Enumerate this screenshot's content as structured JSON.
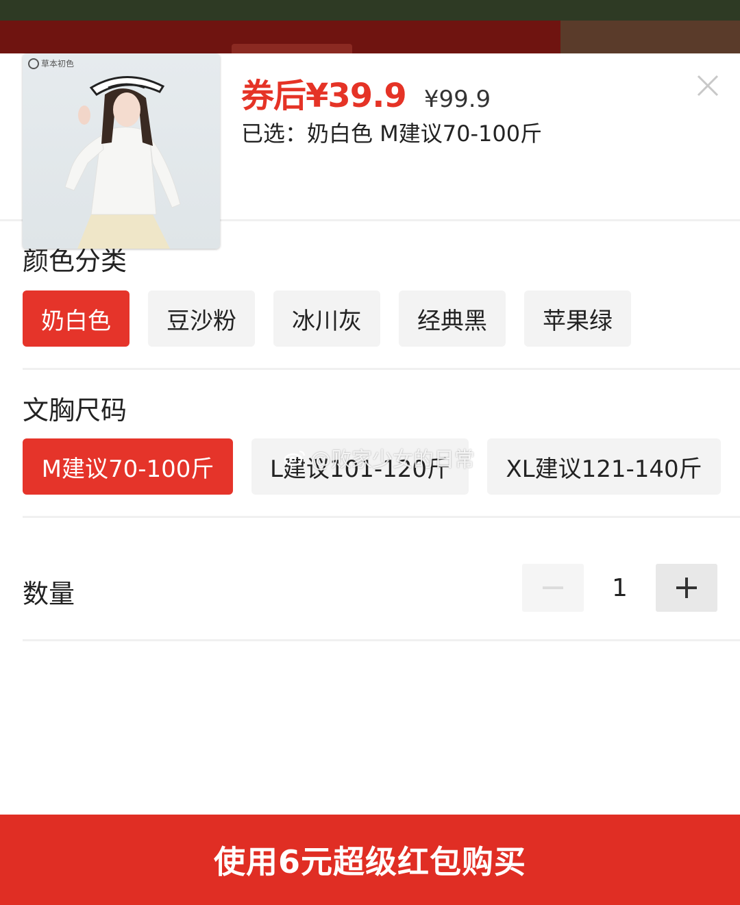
{
  "product": {
    "brand_logo_text": "草本初色",
    "price_after_coupon": "券后¥39.9",
    "original_price": "¥99.9",
    "selected_text": "已选：奶白色 M建议70-100斤"
  },
  "color_section": {
    "title": "颜色分类",
    "options": [
      "奶白色",
      "豆沙粉",
      "冰川灰",
      "经典黑",
      "苹果绿"
    ],
    "selected": "奶白色"
  },
  "size_section": {
    "title": "文胸尺码",
    "options": [
      "M建议70-100斤",
      "L建议101-120斤",
      "XL建议121-140斤"
    ],
    "selected": "M建议70-100斤"
  },
  "quantity": {
    "label": "数量",
    "value": "1"
  },
  "watermark": "@败家少女的日常",
  "buy_button": "使用6元超级红包购买",
  "colors": {
    "accent": "#e5342a",
    "buy_button": "#e02e24",
    "option_bg": "#f3f3f3"
  }
}
